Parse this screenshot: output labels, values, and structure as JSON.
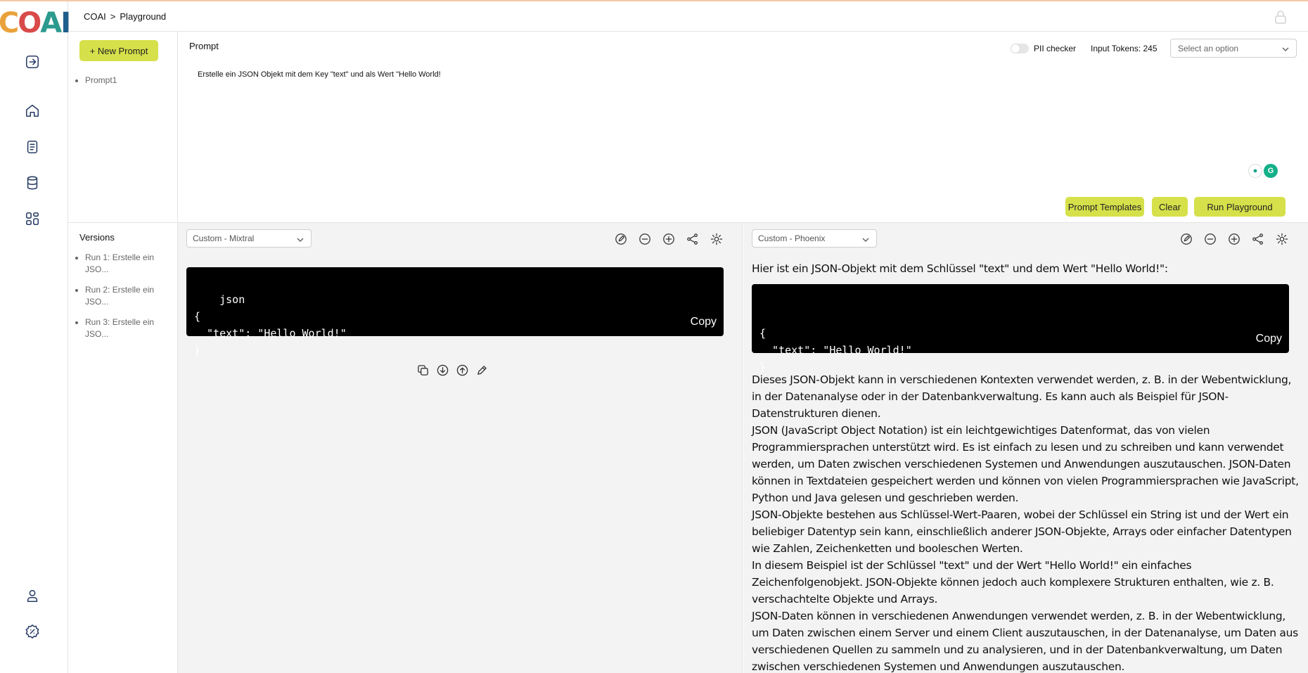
{
  "app": {
    "logo_text": [
      "C",
      "O",
      "A",
      "I"
    ]
  },
  "header": {
    "crumb_root": "COAI",
    "crumb_sep": ">",
    "crumb_page": "Playground"
  },
  "sidebar_nav": [
    "logout-icon",
    "home-icon",
    "document-icon",
    "database-icon",
    "dashboard-icon",
    "user-icon",
    "settings-badge-icon"
  ],
  "prompts": {
    "new_button": "+ New Prompt",
    "items": [
      "Prompt1"
    ]
  },
  "prompt": {
    "title": "Prompt",
    "pii_label": "PII checker",
    "tokens_label": "Input Tokens: 245",
    "select_placeholder": "Select an option",
    "text": "Erstelle ein JSON Objekt mit dem Key \"text\" und als Wert \"Hello World!",
    "actions": {
      "templates": "Prompt Templates",
      "clear": "Clear",
      "run": "Run Playground"
    }
  },
  "versions": {
    "title": "Versions",
    "items": [
      "Run 1: Erstelle ein JSO...",
      "Run 2: Erstelle ein JSO...",
      "Run 3: Erstelle ein JSO..."
    ]
  },
  "left_output": {
    "model": "Custom - Mixtral",
    "code": "json\n{\n  \"text\": \"Hello World!\"\n}",
    "copy_label": "Copy"
  },
  "right_output": {
    "model": "Custom - Phoenix",
    "intro": "Hier ist ein JSON-Objekt mit dem Schlüssel \"text\" und dem Wert \"Hello World!\":",
    "code": "\n{\n  \"text\": \"Hello World!\"\n}",
    "copy_label": "Copy",
    "paragraphs": [
      "Dieses JSON-Objekt kann in verschiedenen Kontexten verwendet werden, z. B. in der Webentwicklung, in der Datenanalyse oder in der Datenbankverwaltung. Es kann auch als Beispiel für JSON-Datenstrukturen dienen.",
      "JSON (JavaScript Object Notation) ist ein leichtgewichtiges Datenformat, das von vielen Programmiersprachen unterstützt wird. Es ist einfach zu lesen und zu schreiben und kann verwendet werden, um Daten zwischen verschiedenen Systemen und Anwendungen auszutauschen. JSON-Daten können in Textdateien gespeichert werden und können von vielen Programmiersprachen wie JavaScript, Python und Java gelesen und geschrieben werden.",
      "JSON-Objekte bestehen aus Schlüssel-Wert-Paaren, wobei der Schlüssel ein String ist und der Wert ein beliebiger Datentyp sein kann, einschließlich anderer JSON-Objekte, Arrays oder einfacher Datentypen wie Zahlen, Zeichenketten und booleschen Werten.",
      "In diesem Beispiel ist der Schlüssel \"text\" und der Wert \"Hello World!\" ein einfaches Zeichenfolgenobjekt. JSON-Objekte können jedoch auch komplexere Strukturen enthalten, wie z. B. verschachtelte Objekte und Arrays.",
      "JSON-Daten können in verschiedenen Anwendungen verwendet werden, z. B. in der Webentwicklung, um Daten zwischen einem Server und einem Client auszutauschen, in der Datenanalyse, um Daten aus verschiedenen Quellen zu sammeln und zu analysieren, und in der Datenbankverwaltung, um Daten zwischen verschiedenen Systemen und Anwendungen auszutauschen."
    ]
  },
  "colors": {
    "accent": "#d6e04a",
    "rail_icon": "#2a3e66",
    "panel_bg": "#f3f3f3"
  }
}
